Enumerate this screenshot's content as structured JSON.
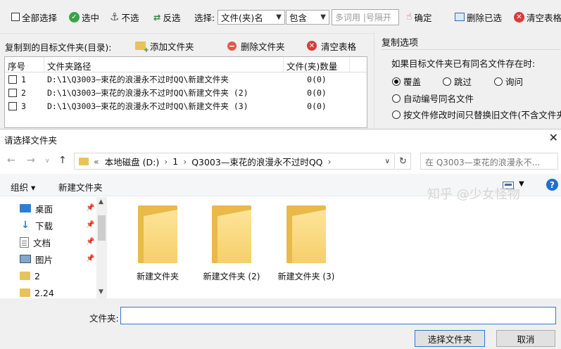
{
  "toolbar": {
    "select_all": "全部选择",
    "select": "选中",
    "unselect": "不选",
    "invert": "反选",
    "choose_label": "选择:",
    "type_select": "文件(夹)名",
    "match_select": "包含",
    "keyword_placeholder": "多词用 |号隔开",
    "confirm": "确定",
    "delete_selected": "删除已选",
    "clear_table": "清空表格"
  },
  "target": {
    "label": "复制到的目标文件夹(目录):",
    "add_folder": "添加文件夹",
    "delete_folder": "删除文件夹",
    "clear_table": "清空表格",
    "columns": [
      "序号",
      "文件夹路径",
      "文件(夹)数量"
    ],
    "rows": [
      {
        "no": "1",
        "path": "D:\\1\\Q3003—束花的浪漫永不过时QQ\\新建文件夹",
        "count": "0(0)"
      },
      {
        "no": "2",
        "path": "D:\\1\\Q3003—束花的浪漫永不过时QQ\\新建文件夹 (2)",
        "count": "0(0)"
      },
      {
        "no": "3",
        "path": "D:\\1\\Q3003—束花的浪漫永不过时QQ\\新建文件夹 (3)",
        "count": "0(0)"
      }
    ]
  },
  "options": {
    "title": "复制选项",
    "question": "如果目标文件夹已有同名文件存在时:",
    "overwrite": "覆盖",
    "skip": "跳过",
    "ask": "询问",
    "auto_rename": "自动编号同名文件",
    "by_time": "按文件修改时间只替换旧文件(不含文件夹)",
    "selected": "overwrite"
  },
  "dialog": {
    "title": "请选择文件夹",
    "close": "✕",
    "breadcrumb": [
      "本地磁盘 (D:)",
      "1",
      "Q3003—束花的浪漫永不过时QQ"
    ],
    "search_placeholder": "在 Q3003—束花的浪漫永不...",
    "organize": "组织 ▾",
    "new_folder": "新建文件夹",
    "nav_items": [
      {
        "label": "桌面",
        "icon": "desktop-icon",
        "pinned": true
      },
      {
        "label": "下载",
        "icon": "download-icon",
        "pinned": true
      },
      {
        "label": "文档",
        "icon": "document-icon",
        "pinned": true
      },
      {
        "label": "图片",
        "icon": "picture-icon",
        "pinned": true
      },
      {
        "label": "2",
        "icon": "folder-icon",
        "pinned": false
      },
      {
        "label": "2.24",
        "icon": "folder-icon",
        "pinned": false
      }
    ],
    "files": [
      "新建文件夹",
      "新建文件夹 (2)",
      "新建文件夹 (3)"
    ],
    "folder_label": "文件夹:",
    "folder_value": "",
    "select_button": "选择文件夹",
    "cancel_button": "取消"
  },
  "watermark": "知乎 @少女怪物"
}
